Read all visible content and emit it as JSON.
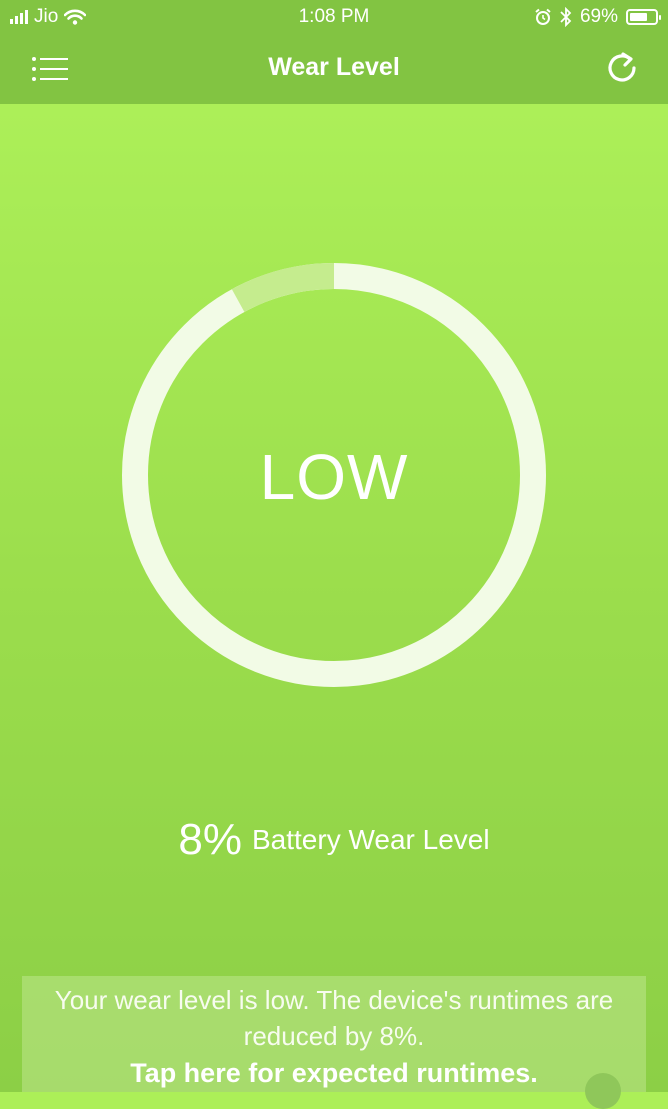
{
  "status_bar": {
    "carrier": "Jio",
    "time": "1:08 PM",
    "battery_percent_label": "69%",
    "battery_level": 0.69
  },
  "header": {
    "title": "Wear Level",
    "menu_icon": "list-menu-icon",
    "refresh_icon": "refresh-icon"
  },
  "gauge": {
    "label": "LOW",
    "wear_fraction": 0.08
  },
  "wear": {
    "percent": "8%",
    "label": "Battery Wear Level"
  },
  "info": {
    "message": "Your wear level is low. The device's runtimes are reduced by 8%.",
    "cta": "Tap here for expected runtimes."
  },
  "colors": {
    "header_bg": "#82c442",
    "accent_green": "#9bdd4c",
    "ring": "#f2fbe6"
  }
}
